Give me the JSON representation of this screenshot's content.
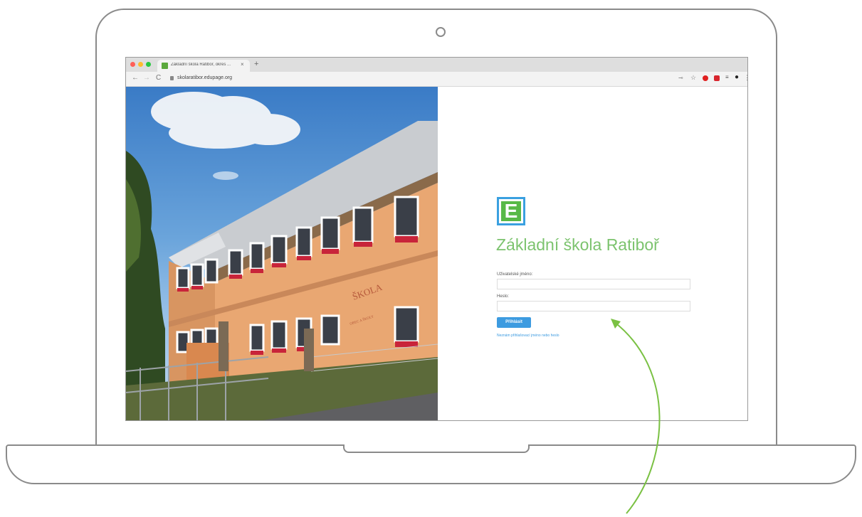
{
  "browser": {
    "tab_title": "Základní škola Ratibor, okres ...",
    "tab_close": "×",
    "new_tab": "+",
    "back": "←",
    "forward": "→",
    "reload": "C",
    "url": "skolaratibor.edupage.org"
  },
  "login": {
    "logo_letter": "E",
    "school_name": "Základní škola Ratiboř",
    "username_label": "Uživatelské jméno:",
    "password_label": "Heslo:",
    "submit_label": "Přihlásit",
    "forgot_link": "Neznám přihlašovací jméno nebo heslo"
  },
  "photo": {
    "sign_main": "ŠKOLA",
    "sign_sub": "OBEC A ŠKOLY"
  },
  "colors": {
    "accent_green": "#7cc36e",
    "logo_green": "#58b947",
    "logo_border": "#3aa0e0",
    "button_blue": "#3d9be0",
    "annotation_arrow": "#7ac143"
  }
}
